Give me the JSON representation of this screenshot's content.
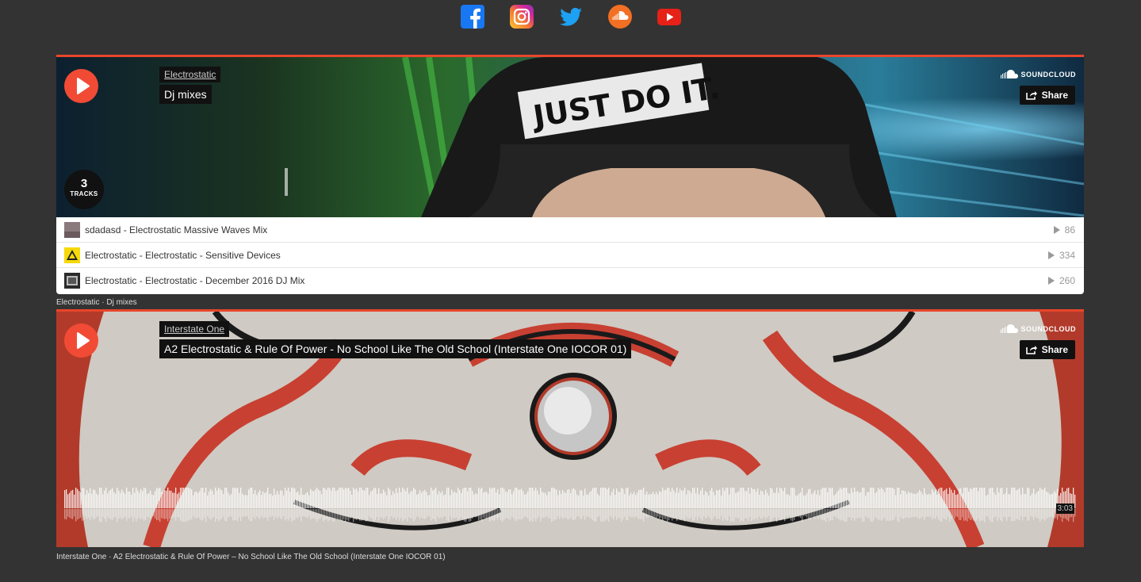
{
  "social": [
    {
      "name": "facebook",
      "icon": "facebook-icon",
      "color": "#1877f2"
    },
    {
      "name": "instagram",
      "icon": "instagram-icon",
      "color": "#d6249f"
    },
    {
      "name": "twitter",
      "icon": "twitter-icon",
      "color": "#1da1f2"
    },
    {
      "name": "soundcloud",
      "icon": "soundcloud-icon",
      "color": "#ff5500"
    },
    {
      "name": "youtube",
      "icon": "youtube-icon",
      "color": "#e62117"
    }
  ],
  "accent_color": "#f14b35",
  "player1": {
    "user": "Electrostatic",
    "title": "Dj mixes",
    "brand": "SOUNDCLOUD",
    "share_label": "Share",
    "track_count": "3",
    "track_count_label": "TRACKS",
    "tracks": [
      {
        "title": "sdadasd - Electrostatic Massive Waves Mix",
        "plays": "86"
      },
      {
        "title": "Electrostatic - Electrostatic - Sensitive Devices",
        "plays": "334"
      },
      {
        "title": "Electrostatic - Electrostatic - December 2016 DJ Mix",
        "plays": "260"
      }
    ],
    "caption": "Electrostatic · Dj mixes"
  },
  "player2": {
    "user": "Interstate One",
    "title": "A2 Electrostatic & Rule Of Power - No School Like The Old School (Interstate One IOCOR 01)",
    "brand": "SOUNDCLOUD",
    "share_label": "Share",
    "duration": "3:03",
    "caption": "Interstate One · A2 Electrostatic & Rule Of Power – No School Like The Old School (Interstate One IOCOR 01)"
  }
}
